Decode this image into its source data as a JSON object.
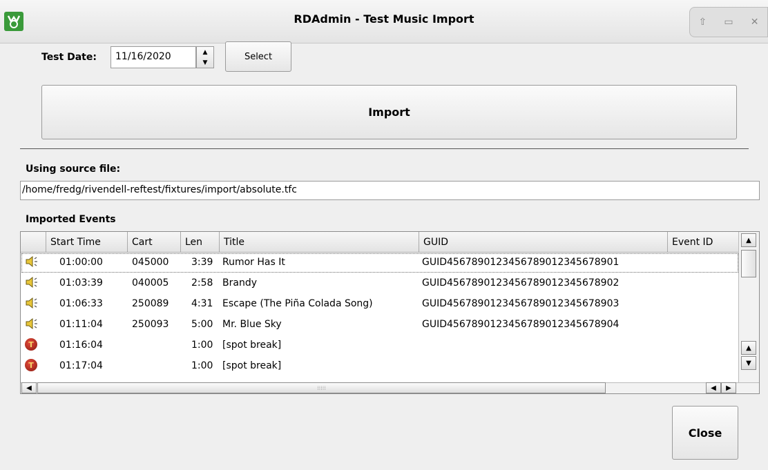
{
  "window": {
    "title": "RDAdmin - Test Music Import",
    "controls": [
      "⇧",
      "▭",
      "✕"
    ]
  },
  "test_date": {
    "label": "Test Date:",
    "value": "11/16/2020",
    "select_label": "Select"
  },
  "import_button": "Import",
  "source": {
    "label": "Using source file:",
    "path": "/home/fredg/rivendell-reftest/fixtures/import/absolute.tfc"
  },
  "events": {
    "label": "Imported Events",
    "columns": [
      "",
      "Start Time",
      "Cart",
      "Len",
      "Title",
      "GUID",
      "Event ID"
    ],
    "rows": [
      {
        "icon": "speaker-icon",
        "start": "01:00:00",
        "cart": "045000",
        "len": "3:39",
        "title": "Rumor Has It",
        "guid": "GUID4567890123456789012345678901",
        "event_id": ""
      },
      {
        "icon": "speaker-icon",
        "start": "01:03:39",
        "cart": "040005",
        "len": "2:58",
        "title": "Brandy",
        "guid": "GUID4567890123456789012345678902",
        "event_id": ""
      },
      {
        "icon": "speaker-icon",
        "start": "01:06:33",
        "cart": "250089",
        "len": "4:31",
        "title": "Escape (The Piña Colada Song)",
        "guid": "GUID4567890123456789012345678903",
        "event_id": ""
      },
      {
        "icon": "speaker-icon",
        "start": "01:11:04",
        "cart": "250093",
        "len": "5:00",
        "title": "Mr. Blue Sky",
        "guid": "GUID4567890123456789012345678904",
        "event_id": ""
      },
      {
        "icon": "traffic-marker-icon",
        "start": "01:16:04",
        "cart": "",
        "len": "1:00",
        "title": "[spot break]",
        "guid": "",
        "event_id": ""
      },
      {
        "icon": "traffic-marker-icon",
        "start": "01:17:04",
        "cart": "",
        "len": "1:00",
        "title": "[spot break]",
        "guid": "",
        "event_id": ""
      }
    ]
  },
  "close_button": "Close"
}
